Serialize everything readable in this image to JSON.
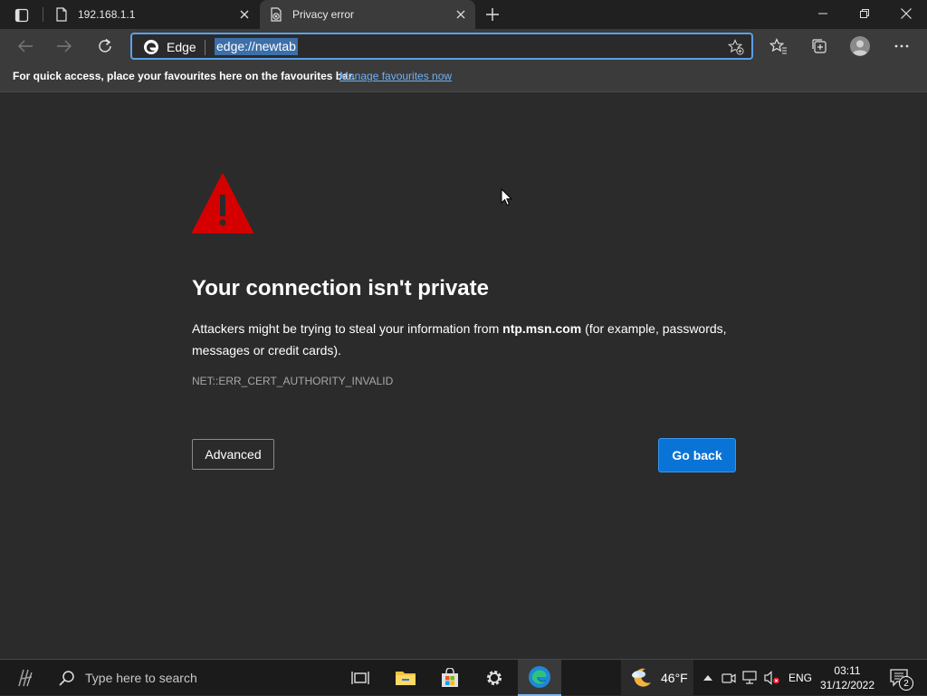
{
  "browser": {
    "tabs": [
      {
        "title": "192.168.1.1",
        "icon": "page-icon",
        "active": false
      },
      {
        "title": "Privacy error",
        "icon": "privacy-error-icon",
        "active": true
      }
    ],
    "address_bar": {
      "site_label": "Edge",
      "url": "edge://newtab"
    },
    "favourites_bar": {
      "message": "For quick access, place your favourites here on the favourites bar.",
      "link": "Manage favourites now"
    }
  },
  "error_page": {
    "title": "Your connection isn't private",
    "description_prefix": "Attackers might be trying to steal your information from ",
    "host": "ntp.msn.com",
    "description_suffix": " (for example, passwords, messages or credit cards).",
    "error_code": "NET::ERR_CERT_AUTHORITY_INVALID",
    "advanced_label": "Advanced",
    "go_back_label": "Go back"
  },
  "taskbar": {
    "search_placeholder": "Type here to search",
    "weather_temp": "46°F",
    "language": "ENG",
    "time": "03:11",
    "date": "31/12/2022",
    "notification_count": "2"
  },
  "colors": {
    "accent": "#0a74d6",
    "warning": "#d40000",
    "link": "#6fb1f5",
    "background": "#2b2b2b"
  }
}
